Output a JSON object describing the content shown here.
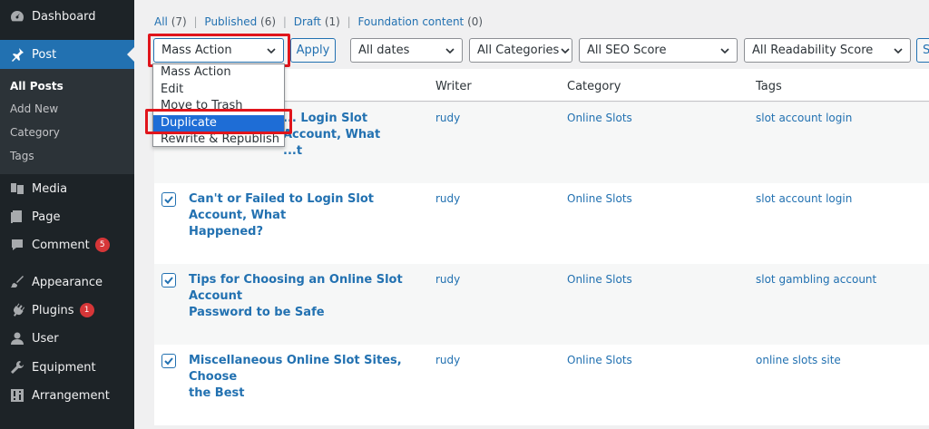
{
  "sidebar": {
    "items": [
      {
        "label": "Dashboard",
        "icon": "dashboard-icon"
      },
      {
        "label": "Post",
        "icon": "pin-icon"
      },
      {
        "label": "Media",
        "icon": "media-icon"
      },
      {
        "label": "Page",
        "icon": "page-icon"
      },
      {
        "label": "Comment",
        "icon": "comment-icon",
        "badge": "5"
      },
      {
        "label": "Appearance",
        "icon": "brush-icon"
      },
      {
        "label": "Plugins",
        "icon": "plugin-icon",
        "badge": "1"
      },
      {
        "label": "User",
        "icon": "user-icon"
      },
      {
        "label": "Equipment",
        "icon": "wrench-icon"
      },
      {
        "label": "Arrangement",
        "icon": "settings-icon"
      }
    ],
    "submenu": [
      "All Posts",
      "Add New",
      "Category",
      "Tags"
    ]
  },
  "views": {
    "all": "All",
    "all_count": "(7)",
    "published": "Published",
    "published_count": "(6)",
    "draft": "Draft",
    "draft_count": "(1)",
    "foundation": "Foundation content",
    "foundation_count": "(0)",
    "separator": "|"
  },
  "toolbar": {
    "bulk_action": "Mass Action",
    "apply": "Apply",
    "dates": "All dates",
    "categories": "All Categories",
    "seo": "All SEO Score",
    "readability": "All Readability Score",
    "filter_partial": "S"
  },
  "dropdown": {
    "options": [
      "Mass Action",
      "Edit",
      "Move to Trash",
      "Duplicate",
      "Rewrite & Republish"
    ],
    "selected": "Duplicate"
  },
  "table": {
    "headers": [
      "Writer",
      "Category",
      "Tags"
    ],
    "rows": [
      {
        "title_line1": "... Login Slot Account, What",
        "title_line2": "...t",
        "writer": "rudy",
        "category": "Online Slots",
        "tags": "slot account login"
      },
      {
        "title_line1": "Can't or Failed to Login Slot Account, What",
        "title_line2": "Happened?",
        "writer": "rudy",
        "category": "Online Slots",
        "tags": "slot account login"
      },
      {
        "title_line1": "Tips for Choosing an Online Slot Account",
        "title_line2": "Password to be Safe",
        "writer": "rudy",
        "category": "Online Slots",
        "tags": "slot gambling account"
      },
      {
        "title_line1": "Miscellaneous Online Slot Sites, Choose",
        "title_line2": "the Best",
        "writer": "rudy",
        "category": "Online Slots",
        "tags": "online slots site"
      }
    ]
  },
  "colors": {
    "accent": "#2271b1",
    "sidebar_bg": "#1d2327",
    "highlight": "#e0151c",
    "selected": "#1e6dd6"
  }
}
